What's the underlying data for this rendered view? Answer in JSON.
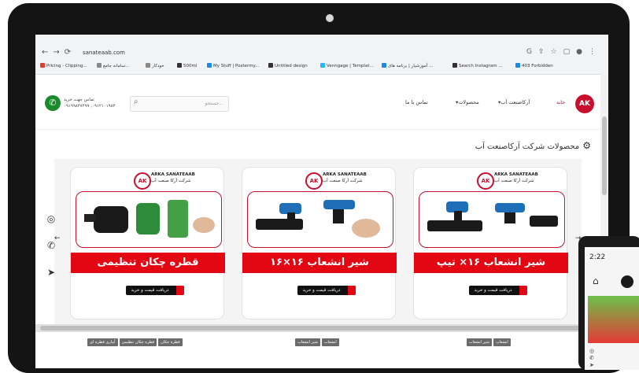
{
  "browser": {
    "url": "sanateaab.com",
    "bookmarks": [
      {
        "label": "Pricing - Clipping...",
        "color": "#e53935"
      },
      {
        "label": "سامانه جامع...",
        "color": "#888888"
      },
      {
        "label": "خودکار",
        "color": "#888888"
      },
      {
        "label": "500ml",
        "color": "#333333"
      },
      {
        "label": "My Stuff | Postermy...",
        "color": "#1e88e5"
      },
      {
        "label": "Untitled design",
        "color": "#333333"
      },
      {
        "label": "Venngage | Templat...",
        "color": "#29b6f6"
      },
      {
        "label": "آموزشیار | برنامه های ...",
        "color": "#1e88e5"
      },
      {
        "label": "Search Instagram ...",
        "color": "#333333"
      },
      {
        "label": "403 Forbidden",
        "color": "#1e88e5"
      }
    ]
  },
  "header": {
    "contact_title": "تماس جهت خرید",
    "contact_numbers": "۰۹۱۹۹۸۴۷۴۹۹ ,۰۹۱۲۱۰۱۹۸۴",
    "search_placeholder": "جستجو...",
    "logo_text": "AK",
    "menu": {
      "home": "خانه",
      "about": "آرکاصنعت آب",
      "products": "محصولات",
      "contact": "تماس با ما"
    }
  },
  "section": {
    "title": "محصولات شرکت آرکاصنعت آب"
  },
  "brand": {
    "name_en": "ARKA SANATEAAB",
    "name_fa": "شرکت آرکا صنعت آب",
    "mark": "AK"
  },
  "products": [
    {
      "title": "قطره چکان تنظیمی",
      "button": "دریافت قیمت و خرید",
      "tags": [
        "قطره چکان",
        "قطره چکان تنظیمی",
        "آبیاری قطره ای"
      ]
    },
    {
      "title": "شیر انشعاب ۱۶×۱۶",
      "button": "دریافت قیمت و خرید",
      "tags": [
        "انشعاب",
        "شیر انشعاب"
      ]
    },
    {
      "title": "شیر انشعاب ۱۶× تیپ",
      "button": "دریافت قیمت و خرید",
      "tags": [
        "انشعاب",
        "شیر انشعاب"
      ]
    }
  ],
  "phone_device": {
    "time": "2:22"
  },
  "colors": {
    "brand_red": "#e30613",
    "accent_green": "#1a8a2a"
  }
}
